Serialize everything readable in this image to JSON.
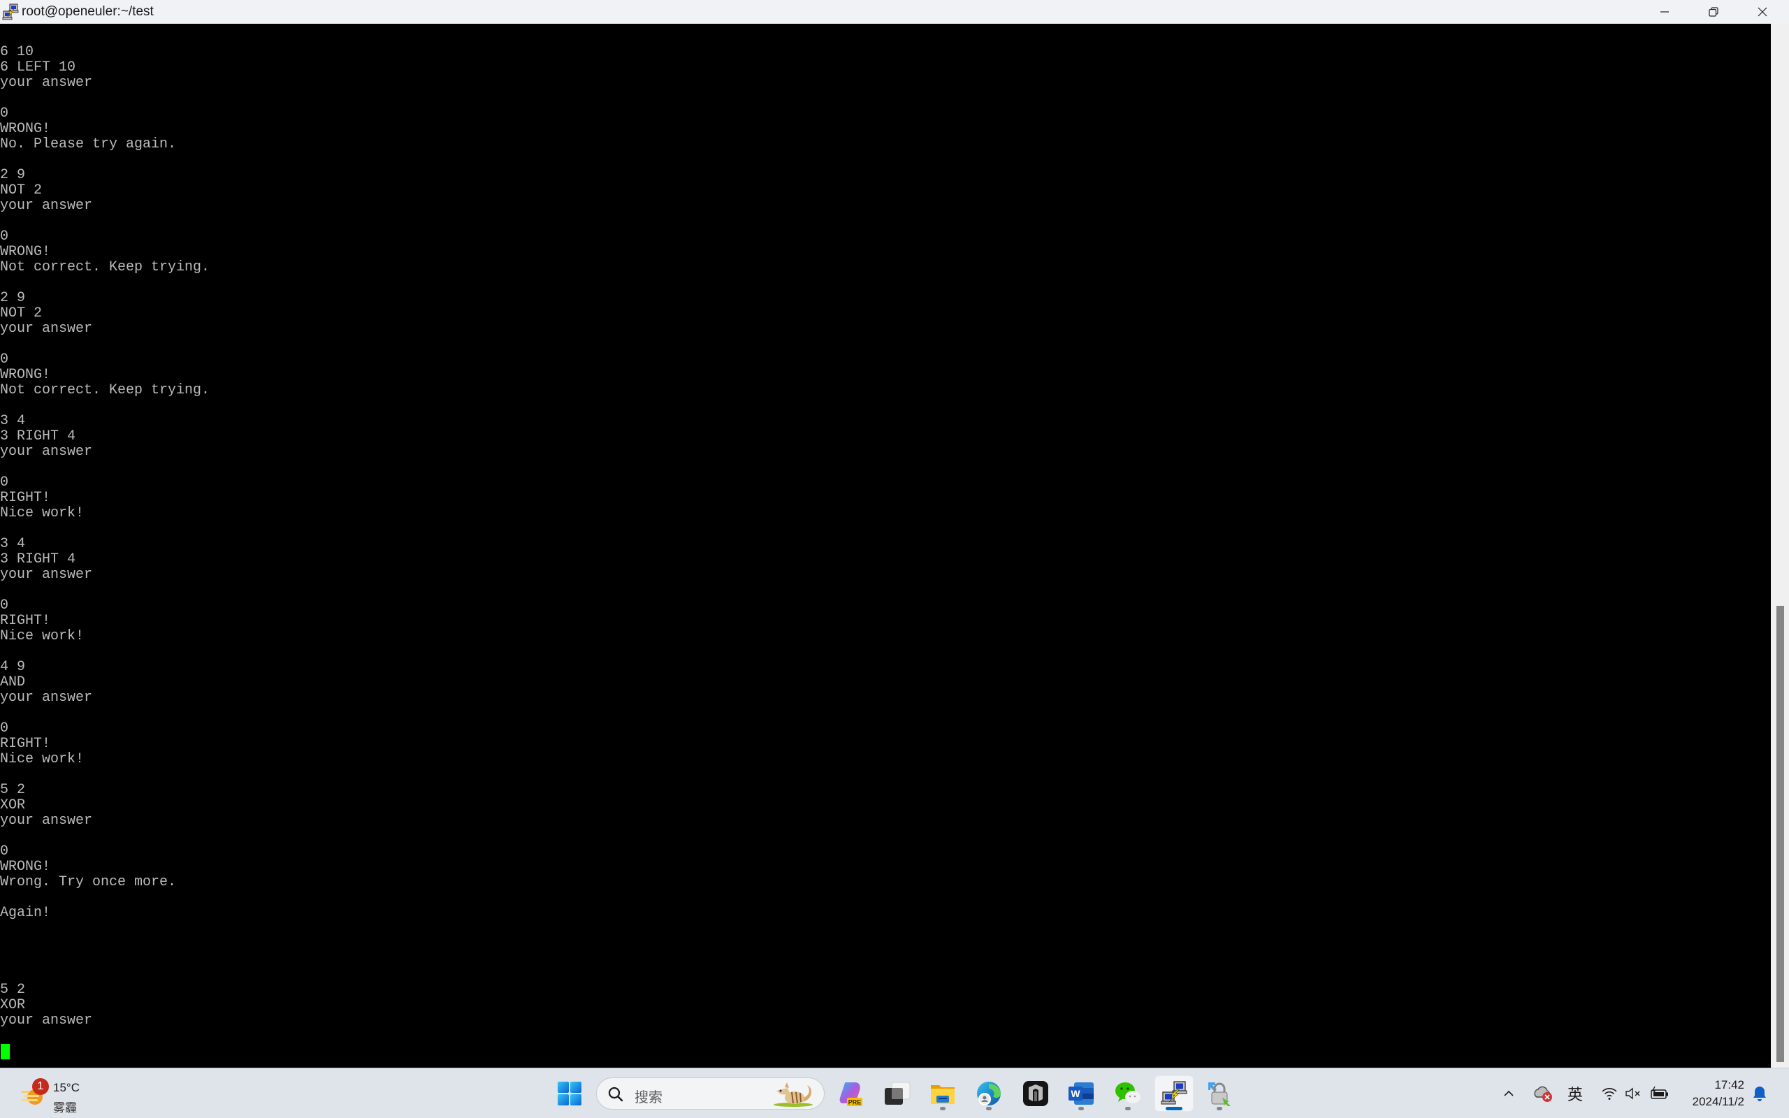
{
  "window": {
    "title": "root@openeuler:~/test",
    "controls": {
      "minimize": "minimize",
      "maximize": "restore",
      "close": "close"
    }
  },
  "terminal": {
    "lines": [
      "",
      "6 10",
      "6 LEFT 10",
      "your answer",
      "",
      "0",
      "WRONG!",
      "No. Please try again.",
      "",
      "2 9",
      "NOT 2",
      "your answer",
      "",
      "0",
      "WRONG!",
      "Not correct. Keep trying.",
      "",
      "2 9",
      "NOT 2",
      "your answer",
      "",
      "0",
      "WRONG!",
      "Not correct. Keep trying.",
      "",
      "3 4",
      "3 RIGHT 4",
      "your answer",
      "",
      "0",
      "RIGHT!",
      "Nice work!",
      "",
      "3 4",
      "3 RIGHT 4",
      "your answer",
      "",
      "0",
      "RIGHT!",
      "Nice work!",
      "",
      "4 9",
      "AND",
      "your answer",
      "",
      "0",
      "RIGHT!",
      "Nice work!",
      "",
      "5 2",
      "XOR",
      "your answer",
      "",
      "0",
      "WRONG!",
      "Wrong. Try once more.",
      "",
      "Again!",
      "",
      "",
      "",
      "",
      "5 2",
      "XOR",
      "your answer",
      ""
    ],
    "cursor_line_index": 66,
    "cursor_color": "#00ff00",
    "text_color": "#bbbbbb",
    "scroll_position_fraction": 0.55
  },
  "taskbar": {
    "weather": {
      "temperature": "15°C",
      "condition": "雾霾",
      "badge": "1"
    },
    "search": {
      "placeholder": "搜索"
    },
    "apps": [
      {
        "name": "Copilot PRE",
        "running": false,
        "badge": "PRE"
      },
      {
        "name": "Task View",
        "running": false
      },
      {
        "name": "File Explorer",
        "running": true
      },
      {
        "name": "Microsoft Edge",
        "running": true
      },
      {
        "name": "Dark App",
        "running": false
      },
      {
        "name": "Microsoft Word",
        "running": true
      },
      {
        "name": "WeChat",
        "running": true
      },
      {
        "name": "PuTTY",
        "running": true,
        "active": true
      },
      {
        "name": "PuTTYgen",
        "running": true
      }
    ],
    "tray": {
      "ime": "英",
      "time": "17:42",
      "date": "2024/11/2"
    }
  }
}
